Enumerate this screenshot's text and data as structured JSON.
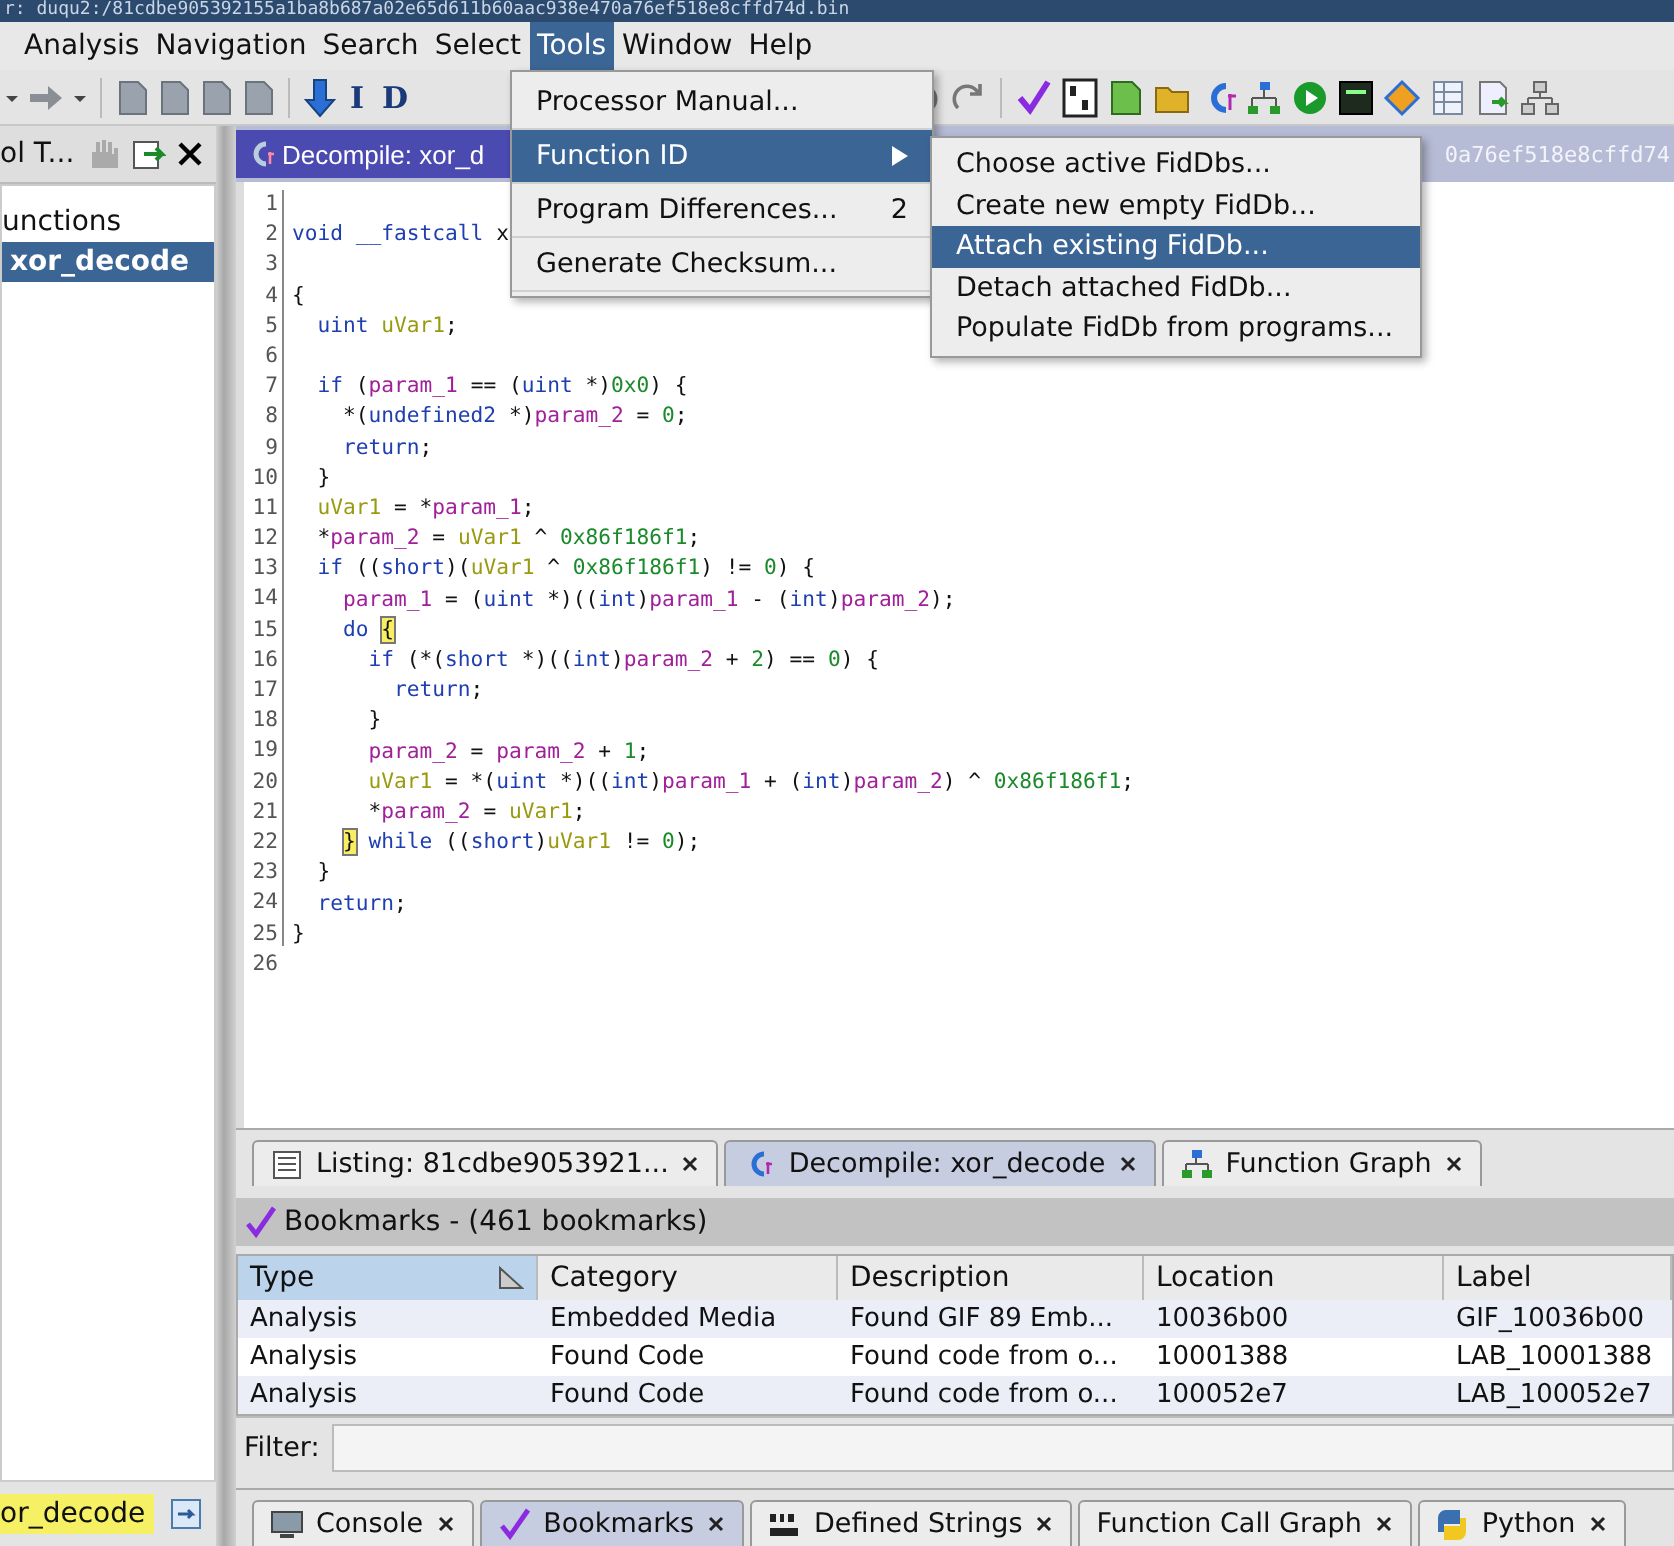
{
  "window": {
    "title": "r: duqu2:/81cdbe905392155a1ba8b687a02e65d611b60aac938e470a76ef518e8cffd74d.bin"
  },
  "menu_bar": [
    {
      "label": "Analysis",
      "selected": false
    },
    {
      "label": "Navigation",
      "selected": false
    },
    {
      "label": "Search",
      "selected": false
    },
    {
      "label": "Select",
      "selected": false
    },
    {
      "label": "Tools",
      "selected": true
    },
    {
      "label": "Window",
      "selected": false
    },
    {
      "label": "Help",
      "selected": false
    }
  ],
  "toolbar": {
    "glyphs": [
      "I",
      "D"
    ]
  },
  "tools_menu": [
    {
      "label": "Processor Manual...",
      "selected": false
    },
    {
      "label": "Function ID",
      "selected": true,
      "submenu": true
    },
    {
      "label": "Program Differences...",
      "shortcut": "2",
      "selected": false
    },
    {
      "label": "Generate Checksum...",
      "selected": false
    }
  ],
  "function_id_menu": [
    {
      "label": "Choose active FidDbs...",
      "selected": false
    },
    {
      "label": "Create new empty FidDb...",
      "selected": false
    },
    {
      "label": "Attach existing FidDb...",
      "selected": true
    },
    {
      "label": "Detach attached FidDb...",
      "selected": false
    },
    {
      "label": "Populate FidDb from programs...",
      "selected": false
    }
  ],
  "left_panel": {
    "title": "ol T...",
    "tree": [
      {
        "label": "unctions",
        "selected": false
      },
      {
        "label": "xor_decode",
        "selected": true
      }
    ],
    "field": "or_decode"
  },
  "decompiler": {
    "title": "Decompile: xor_d",
    "subtitle": "0a76ef518e8cffd74",
    "lines": [
      {
        "n": "1"
      },
      {
        "n": "2",
        "tokens": [
          {
            "kind": "type",
            "text": "void "
          },
          {
            "kind": "type",
            "text": "__fastcall "
          },
          {
            "kind": "plain",
            "text": "x"
          }
        ]
      },
      {
        "n": "3"
      },
      {
        "n": "4",
        "tokens": [
          {
            "kind": "plain",
            "text": "{"
          }
        ]
      },
      {
        "n": "5",
        "tokens": [
          {
            "kind": "type",
            "text": "  uint "
          },
          {
            "kind": "local",
            "text": "uVar1"
          },
          {
            "kind": "plain",
            "text": ";"
          }
        ]
      },
      {
        "n": "6"
      },
      {
        "n": "7",
        "tokens": [
          {
            "kind": "keyword",
            "text": "  if"
          },
          {
            "kind": "plain",
            "text": " ("
          },
          {
            "kind": "param",
            "text": "param_1"
          },
          {
            "kind": "plain",
            "text": " == ("
          },
          {
            "kind": "type",
            "text": "uint"
          },
          {
            "kind": "plain",
            "text": " *)"
          },
          {
            "kind": "number",
            "text": "0x0"
          },
          {
            "kind": "plain",
            "text": ") {"
          }
        ]
      },
      {
        "n": "8",
        "tokens": [
          {
            "kind": "plain",
            "text": "    *("
          },
          {
            "kind": "type",
            "text": "undefined2"
          },
          {
            "kind": "plain",
            "text": " *)"
          },
          {
            "kind": "param",
            "text": "param_2"
          },
          {
            "kind": "plain",
            "text": " = "
          },
          {
            "kind": "number",
            "text": "0"
          },
          {
            "kind": "plain",
            "text": ";"
          }
        ]
      },
      {
        "n": "9",
        "tokens": [
          {
            "kind": "keyword",
            "text": "    return"
          },
          {
            "kind": "plain",
            "text": ";"
          }
        ]
      },
      {
        "n": "10",
        "tokens": [
          {
            "kind": "plain",
            "text": "  }"
          }
        ]
      },
      {
        "n": "11",
        "tokens": [
          {
            "kind": "local",
            "text": "  uVar1"
          },
          {
            "kind": "plain",
            "text": " = *"
          },
          {
            "kind": "param",
            "text": "param_1"
          },
          {
            "kind": "plain",
            "text": ";"
          }
        ]
      },
      {
        "n": "12",
        "tokens": [
          {
            "kind": "plain",
            "text": "  *"
          },
          {
            "kind": "param",
            "text": "param_2"
          },
          {
            "kind": "plain",
            "text": " = "
          },
          {
            "kind": "local",
            "text": "uVar1"
          },
          {
            "kind": "plain",
            "text": " ^ "
          },
          {
            "kind": "number",
            "text": "0x86f186f1"
          },
          {
            "kind": "plain",
            "text": ";"
          }
        ]
      },
      {
        "n": "13",
        "tokens": [
          {
            "kind": "keyword",
            "text": "  if"
          },
          {
            "kind": "plain",
            "text": " (("
          },
          {
            "kind": "type",
            "text": "short"
          },
          {
            "kind": "plain",
            "text": ")("
          },
          {
            "kind": "local",
            "text": "uVar1"
          },
          {
            "kind": "plain",
            "text": " ^ "
          },
          {
            "kind": "number",
            "text": "0x86f186f1"
          },
          {
            "kind": "plain",
            "text": ") != "
          },
          {
            "kind": "number",
            "text": "0"
          },
          {
            "kind": "plain",
            "text": ") {"
          }
        ]
      },
      {
        "n": "14",
        "tokens": [
          {
            "kind": "param",
            "text": "    param_1"
          },
          {
            "kind": "plain",
            "text": " = ("
          },
          {
            "kind": "type",
            "text": "uint"
          },
          {
            "kind": "plain",
            "text": " *)(("
          },
          {
            "kind": "type",
            "text": "int"
          },
          {
            "kind": "plain",
            "text": ")"
          },
          {
            "kind": "param",
            "text": "param_1"
          },
          {
            "kind": "plain",
            "text": " - ("
          },
          {
            "kind": "type",
            "text": "int"
          },
          {
            "kind": "plain",
            "text": ")"
          },
          {
            "kind": "param",
            "text": "param_2"
          },
          {
            "kind": "plain",
            "text": ");"
          }
        ]
      },
      {
        "n": "15",
        "tokens": [
          {
            "kind": "keyword",
            "text": "    do "
          },
          {
            "kind": "match",
            "text": "{"
          }
        ]
      },
      {
        "n": "16",
        "tokens": [
          {
            "kind": "keyword",
            "text": "      if"
          },
          {
            "kind": "plain",
            "text": " (*("
          },
          {
            "kind": "type",
            "text": "short"
          },
          {
            "kind": "plain",
            "text": " *)(("
          },
          {
            "kind": "type",
            "text": "int"
          },
          {
            "kind": "plain",
            "text": ")"
          },
          {
            "kind": "param",
            "text": "param_2"
          },
          {
            "kind": "plain",
            "text": " + "
          },
          {
            "kind": "number",
            "text": "2"
          },
          {
            "kind": "plain",
            "text": ") == "
          },
          {
            "kind": "number",
            "text": "0"
          },
          {
            "kind": "plain",
            "text": ") {"
          }
        ]
      },
      {
        "n": "17",
        "tokens": [
          {
            "kind": "keyword",
            "text": "        return"
          },
          {
            "kind": "plain",
            "text": ";"
          }
        ]
      },
      {
        "n": "18",
        "tokens": [
          {
            "kind": "plain",
            "text": "      }"
          }
        ]
      },
      {
        "n": "19",
        "tokens": [
          {
            "kind": "param",
            "text": "      param_2"
          },
          {
            "kind": "plain",
            "text": " = "
          },
          {
            "kind": "param",
            "text": "param_2"
          },
          {
            "kind": "plain",
            "text": " + "
          },
          {
            "kind": "number",
            "text": "1"
          },
          {
            "kind": "plain",
            "text": ";"
          }
        ]
      },
      {
        "n": "20",
        "tokens": [
          {
            "kind": "local",
            "text": "      uVar1"
          },
          {
            "kind": "plain",
            "text": " = *("
          },
          {
            "kind": "type",
            "text": "uint"
          },
          {
            "kind": "plain",
            "text": " *)(("
          },
          {
            "kind": "type",
            "text": "int"
          },
          {
            "kind": "plain",
            "text": ")"
          },
          {
            "kind": "param",
            "text": "param_1"
          },
          {
            "kind": "plain",
            "text": " + ("
          },
          {
            "kind": "type",
            "text": "int"
          },
          {
            "kind": "plain",
            "text": ")"
          },
          {
            "kind": "param",
            "text": "param_2"
          },
          {
            "kind": "plain",
            "text": ") ^ "
          },
          {
            "kind": "number",
            "text": "0x86f186f1"
          },
          {
            "kind": "plain",
            "text": ";"
          }
        ]
      },
      {
        "n": "21",
        "tokens": [
          {
            "kind": "plain",
            "text": "      *"
          },
          {
            "kind": "param",
            "text": "param_2"
          },
          {
            "kind": "plain",
            "text": " = "
          },
          {
            "kind": "local",
            "text": "uVar1"
          },
          {
            "kind": "plain",
            "text": ";"
          }
        ]
      },
      {
        "n": "22",
        "tokens": [
          {
            "kind": "match_indented",
            "text": "}"
          },
          {
            "kind": "keyword",
            "text": " while"
          },
          {
            "kind": "plain",
            "text": " (("
          },
          {
            "kind": "type",
            "text": "short"
          },
          {
            "kind": "plain",
            "text": ")"
          },
          {
            "kind": "local",
            "text": "uVar1"
          },
          {
            "kind": "plain",
            "text": " != "
          },
          {
            "kind": "number",
            "text": "0"
          },
          {
            "kind": "plain",
            "text": ");"
          }
        ]
      },
      {
        "n": "23",
        "tokens": [
          {
            "kind": "plain",
            "text": "  }"
          }
        ]
      },
      {
        "n": "24",
        "tokens": [
          {
            "kind": "keyword",
            "text": "  return"
          },
          {
            "kind": "plain",
            "text": ";"
          }
        ]
      },
      {
        "n": "25",
        "tokens": [
          {
            "kind": "plain",
            "text": "}"
          }
        ]
      },
      {
        "n": "26"
      }
    ]
  },
  "view_tabs": [
    {
      "label": "Listing: 81cdbe9053921...",
      "kind": "listing",
      "selected": false
    },
    {
      "label": "Decompile: xor_decode",
      "kind": "decompile",
      "selected": true
    },
    {
      "label": "Function Graph",
      "kind": "graph",
      "selected": false
    }
  ],
  "bookmarks": {
    "title": "Bookmarks - (461 bookmarks)",
    "columns": [
      {
        "label": "Type",
        "sorted": true
      },
      {
        "label": "Category",
        "sorted": false
      },
      {
        "label": "Description",
        "sorted": false
      },
      {
        "label": "Location",
        "sorted": false
      },
      {
        "label": "Label",
        "sorted": false
      }
    ],
    "rows": [
      [
        "Analysis",
        "Embedded Media",
        "Found GIF 89 Emb...",
        "10036b00",
        "GIF_10036b00"
      ],
      [
        "Analysis",
        "Found Code",
        "Found code from o...",
        "10001388",
        "LAB_10001388"
      ],
      [
        "Analysis",
        "Found Code",
        "Found code from o...",
        "100052e7",
        "LAB_100052e7"
      ]
    ],
    "filter_label": "Filter:"
  },
  "bottom_tabs": [
    {
      "label": "Console",
      "kind": "console",
      "selected": false
    },
    {
      "label": "Bookmarks",
      "kind": "bookmarks",
      "selected": true
    },
    {
      "label": "Defined Strings",
      "kind": "strings",
      "selected": false
    },
    {
      "label": "Function Call Graph",
      "kind": "callgraph",
      "selected": false
    },
    {
      "label": "Python",
      "kind": "python",
      "selected": false
    }
  ]
}
